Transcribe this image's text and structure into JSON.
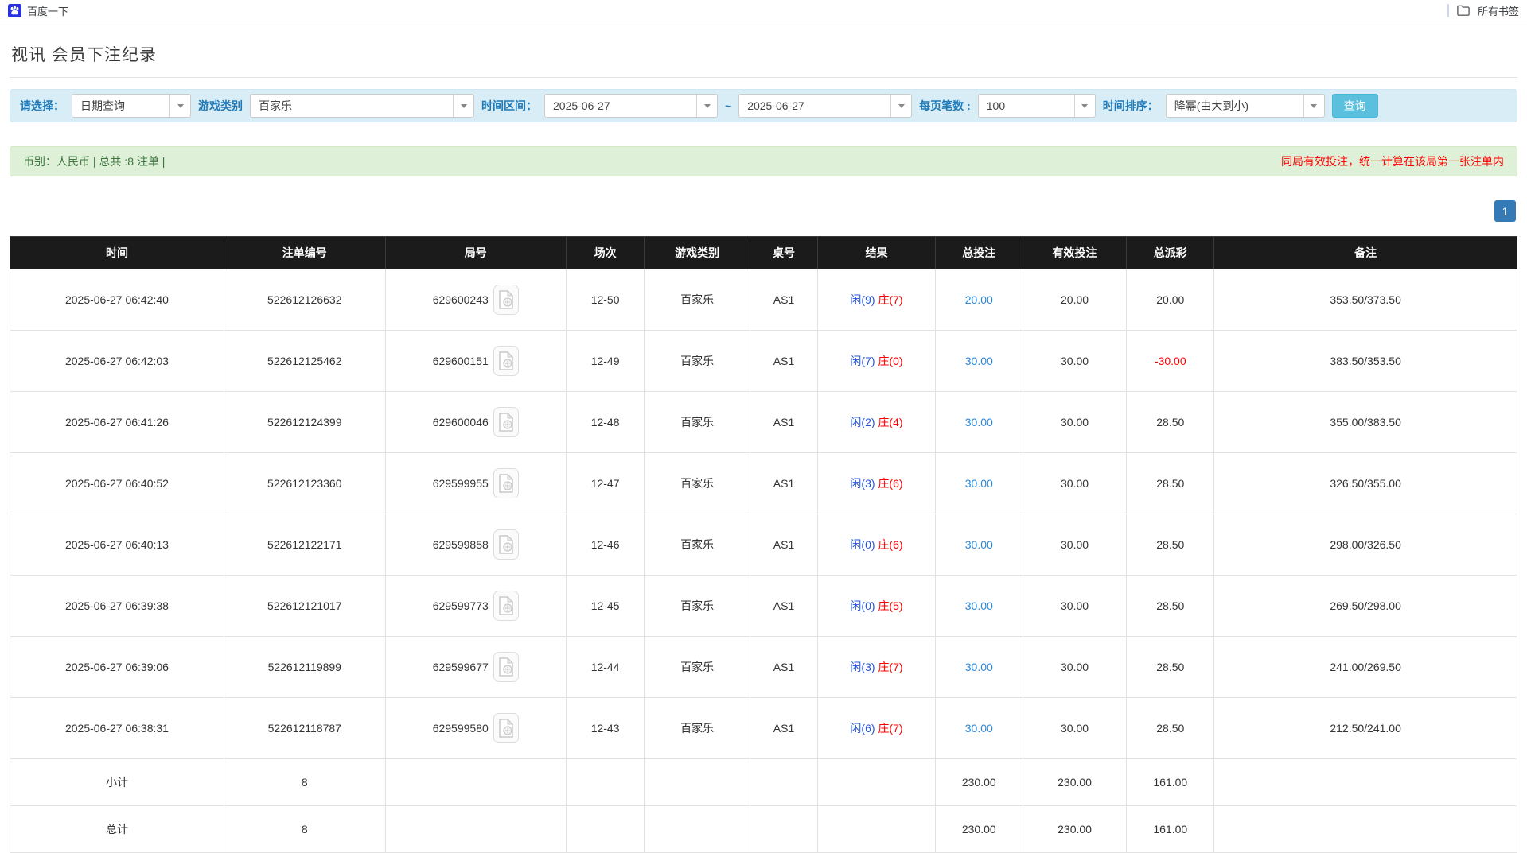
{
  "bookmarks_bar": {
    "bookmark_label": "百度一下",
    "all_bookmarks_label": "所有书签"
  },
  "page": {
    "title": "视讯 会员下注纪录"
  },
  "filters": {
    "select_label": "请选择：",
    "select_value": "日期查询",
    "game_type_label": "游戏类别",
    "game_type_value": "百家乐",
    "date_range_label": "时间区间：",
    "date_from": "2025-06-27",
    "date_separator": "~",
    "date_to": "2025-06-27",
    "page_size_label": "每页笔数 :",
    "page_size_value": "100",
    "sort_label": "时间排序：",
    "sort_value": "降幂(由大到小)",
    "search_button": "查询"
  },
  "summary_bar": {
    "left_text": "币别：人民币 | 总共 :8 注单 |",
    "right_notice": "同局有效投注，统一计算在该局第一张注单内"
  },
  "pagination": {
    "current_page": "1"
  },
  "colors": {
    "accent_blue": "#5bc0de",
    "link_blue": "#2b87d8",
    "player_blue": "#2255dd",
    "banker_red": "#ff0000",
    "success_green": "#3c763d",
    "header_black": "#1b1b1b",
    "summary_gray": "#9d9d9d"
  },
  "table": {
    "headers": [
      "时间",
      "注单编号",
      "局号",
      "场次",
      "游戏类别",
      "桌号",
      "结果",
      "总投注",
      "有效投注",
      "总派彩",
      "备注"
    ],
    "rows": [
      {
        "time": "2025-06-27 06:42:40",
        "bet_id": "522612126632",
        "round_id": "629600243",
        "session": "12-50",
        "game": "百家乐",
        "table_no": "AS1",
        "result_player": "闲(9)",
        "result_banker": "庄(7)",
        "total_bet": "20.00",
        "valid_bet": "20.00",
        "payout": "20.00",
        "payout_negative": false,
        "remark": "353.50/373.50"
      },
      {
        "time": "2025-06-27 06:42:03",
        "bet_id": "522612125462",
        "round_id": "629600151",
        "session": "12-49",
        "game": "百家乐",
        "table_no": "AS1",
        "result_player": "闲(7)",
        "result_banker": "庄(0)",
        "total_bet": "30.00",
        "valid_bet": "30.00",
        "payout": "-30.00",
        "payout_negative": true,
        "remark": "383.50/353.50"
      },
      {
        "time": "2025-06-27 06:41:26",
        "bet_id": "522612124399",
        "round_id": "629600046",
        "session": "12-48",
        "game": "百家乐",
        "table_no": "AS1",
        "result_player": "闲(2)",
        "result_banker": "庄(4)",
        "total_bet": "30.00",
        "valid_bet": "30.00",
        "payout": "28.50",
        "payout_negative": false,
        "remark": "355.00/383.50"
      },
      {
        "time": "2025-06-27 06:40:52",
        "bet_id": "522612123360",
        "round_id": "629599955",
        "session": "12-47",
        "game": "百家乐",
        "table_no": "AS1",
        "result_player": "闲(3)",
        "result_banker": "庄(6)",
        "total_bet": "30.00",
        "valid_bet": "30.00",
        "payout": "28.50",
        "payout_negative": false,
        "remark": "326.50/355.00"
      },
      {
        "time": "2025-06-27 06:40:13",
        "bet_id": "522612122171",
        "round_id": "629599858",
        "session": "12-46",
        "game": "百家乐",
        "table_no": "AS1",
        "result_player": "闲(0)",
        "result_banker": "庄(6)",
        "total_bet": "30.00",
        "valid_bet": "30.00",
        "payout": "28.50",
        "payout_negative": false,
        "remark": "298.00/326.50"
      },
      {
        "time": "2025-06-27 06:39:38",
        "bet_id": "522612121017",
        "round_id": "629599773",
        "session": "12-45",
        "game": "百家乐",
        "table_no": "AS1",
        "result_player": "闲(0)",
        "result_banker": "庄(5)",
        "total_bet": "30.00",
        "valid_bet": "30.00",
        "payout": "28.50",
        "payout_negative": false,
        "remark": "269.50/298.00"
      },
      {
        "time": "2025-06-27 06:39:06",
        "bet_id": "522612119899",
        "round_id": "629599677",
        "session": "12-44",
        "game": "百家乐",
        "table_no": "AS1",
        "result_player": "闲(3)",
        "result_banker": "庄(7)",
        "total_bet": "30.00",
        "valid_bet": "30.00",
        "payout": "28.50",
        "payout_negative": false,
        "remark": "241.00/269.50"
      },
      {
        "time": "2025-06-27 06:38:31",
        "bet_id": "522612118787",
        "round_id": "629599580",
        "session": "12-43",
        "game": "百家乐",
        "table_no": "AS1",
        "result_player": "闲(6)",
        "result_banker": "庄(7)",
        "total_bet": "30.00",
        "valid_bet": "30.00",
        "payout": "28.50",
        "payout_negative": false,
        "remark": "212.50/241.00"
      }
    ],
    "subtotal": {
      "label": "小计",
      "count": "8",
      "total_bet": "230.00",
      "valid_bet": "230.00",
      "payout": "161.00"
    },
    "total": {
      "label": "总计",
      "count": "8",
      "total_bet": "230.00",
      "valid_bet": "230.00",
      "payout": "161.00"
    }
  }
}
